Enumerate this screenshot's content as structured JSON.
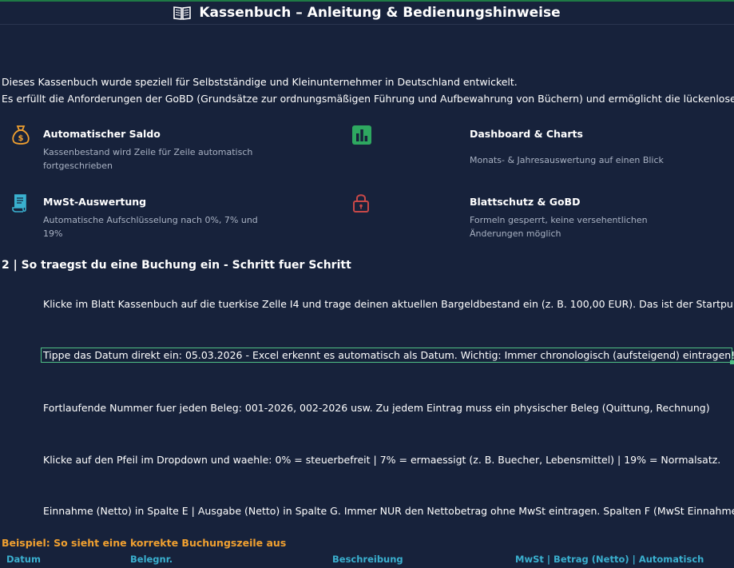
{
  "title": "Kassenbuch – Anleitung & Bedienungshinweise",
  "intro": {
    "line1": "Dieses Kassenbuch wurde speziell für Selbstständige und Kleinunternehmer in Deutschland entwickelt.",
    "line2": "Es erfüllt die Anforderungen der GoBD (Grundsätze zur ordnungsmäßigen Führung und Aufbewahrung von Büchern) und ermöglicht die lückenlose,"
  },
  "features": [
    {
      "title": "Automatischer Saldo",
      "desc": "Kassenbestand wird Zeile für Zeile automatisch fortgeschrieben",
      "icon": "money-bag-icon",
      "color": "#f0a030"
    },
    {
      "title": "Dashboard & Charts",
      "desc": "Monats- & Jahresauswertung auf einen Blick",
      "icon": "bar-chart-icon",
      "color": "#2ea860"
    },
    {
      "title": "MwSt-Auswertung",
      "desc": "Automatische Aufschlüsselung nach 0%, 7% und 19%",
      "icon": "scroll-icon",
      "color": "#3ab0cf"
    },
    {
      "title": "Blattschutz & GoBD",
      "desc": "Formeln gesperrt, keine versehentlichen Änderungen möglich",
      "icon": "lock-icon",
      "color": "#c74848"
    }
  ],
  "section": {
    "heading": "2  |  So traegst du eine Buchung ein - Schritt fuer Schritt"
  },
  "steps": [
    "Klicke im Blatt Kassenbuch auf die tuerkise Zelle I4 und trage deinen aktuellen Bargeldbestand ein (z. B. 100,00 EUR). Das ist der Startpunkt",
    "Tippe das Datum direkt ein: 05.03.2026 - Excel erkennt es automatisch als Datum. Wichtig: Immer chronologisch (aufsteigend) eintragen!",
    "Fortlaufende Nummer fuer jeden Beleg: 001-2026, 002-2026 usw. Zu jedem Eintrag muss ein physischer Beleg (Quittung, Rechnung)",
    "Klicke auf den Pfeil im Dropdown und waehle: 0% = steuerbefreit | 7% = ermaessigt (z. B. Buecher, Lebensmittel) | 19% = Normalsatz.",
    "Einnahme (Netto) in Spalte E | Ausgabe (Netto) in Spalte G. Immer NUR den Nettobetrag ohne MwSt eintragen. Spalten F (MwSt Einnahme),"
  ],
  "example": {
    "title": "Beispiel: So sieht eine korrekte Buchungszeile aus",
    "columns": [
      "Datum",
      "Belegnr.",
      "Beschreibung",
      "MwSt  |  Betrag (Netto)  |  Automatisch"
    ]
  },
  "colors": {
    "background": "#17223b",
    "accent_green": "#4fbf85",
    "orange": "#f0a030",
    "cyan": "#3ab0cf"
  }
}
